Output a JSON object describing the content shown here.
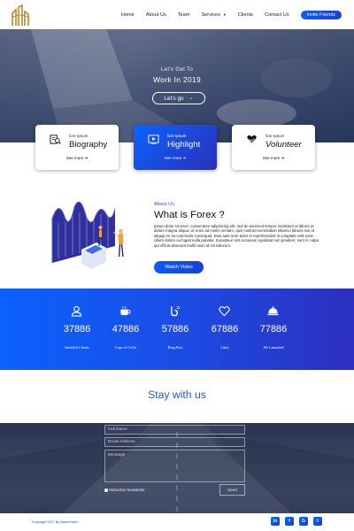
{
  "nav": {
    "links": [
      "Home",
      "About Us",
      "Team",
      "Services",
      "Clients",
      "Contact Us"
    ],
    "cta_label": "Invite Friends"
  },
  "hero": {
    "subtitle": "Let's Get To",
    "title": "Work In 2019",
    "button_label": "Let's go"
  },
  "cards": [
    {
      "small": "lore Ipsum",
      "title": "Biography",
      "more": "See more",
      "icon": "biography-search-icon"
    },
    {
      "small": "lore Ipsum",
      "title": "Highlight",
      "more": "See more",
      "icon": "video-play-icon"
    },
    {
      "small": "lore Ipsum",
      "title": "Volunteer",
      "more": "See more",
      "icon": "heart-hands-icon"
    }
  ],
  "about": {
    "kicker": "About Us",
    "title": "What is Forex ?",
    "body": "Ipsum dolor sit amet, consectetur adipisicing elit, sed do eiusmod tempor incididunt ut labore et dolore magna aliqua. Ut enim ad minim veniam, quis nostrud exercitation ullamco laboris nisi ut aliquip ex ea commodo consequat. Duis aute irure dolor in reprehenderit in voluptate velit esse cillum dolore eu fugiat nulla pariatur. Excepteur sint occaecat cupidatat non proident, sunt in culpa qui officia deserunt mollit anim id est laborum.",
    "button_label": "Watch Video"
  },
  "stats": [
    {
      "icon": "person-icon",
      "value": "37886",
      "label": "Satisfied Clients"
    },
    {
      "icon": "coffee-cup-icon",
      "value": "47886",
      "label": "Cups of Coffe"
    },
    {
      "icon": "blog-icon",
      "value": "57886",
      "label": "Blog Post"
    },
    {
      "icon": "heart-icon",
      "value": "67886",
      "label": "Likes"
    },
    {
      "icon": "cloche-icon",
      "value": "77886",
      "label": "We Launched"
    }
  ],
  "stay": {
    "title": "Stay with us"
  },
  "form": {
    "full_name_placeholder": "Full Name",
    "email_placeholder": "Email Address",
    "message_placeholder": "Message",
    "subscribe_label": "Subscribe Newsletter",
    "send_label": "Send"
  },
  "footer": {
    "copyright": "Copyright 2017 By NameHatfor",
    "socials": [
      "in",
      "f",
      "G",
      "t"
    ]
  },
  "colors": {
    "accent": "#0a5bff",
    "accent_dark": "#2d2fc0",
    "title_blue": "#1b5ecf"
  }
}
